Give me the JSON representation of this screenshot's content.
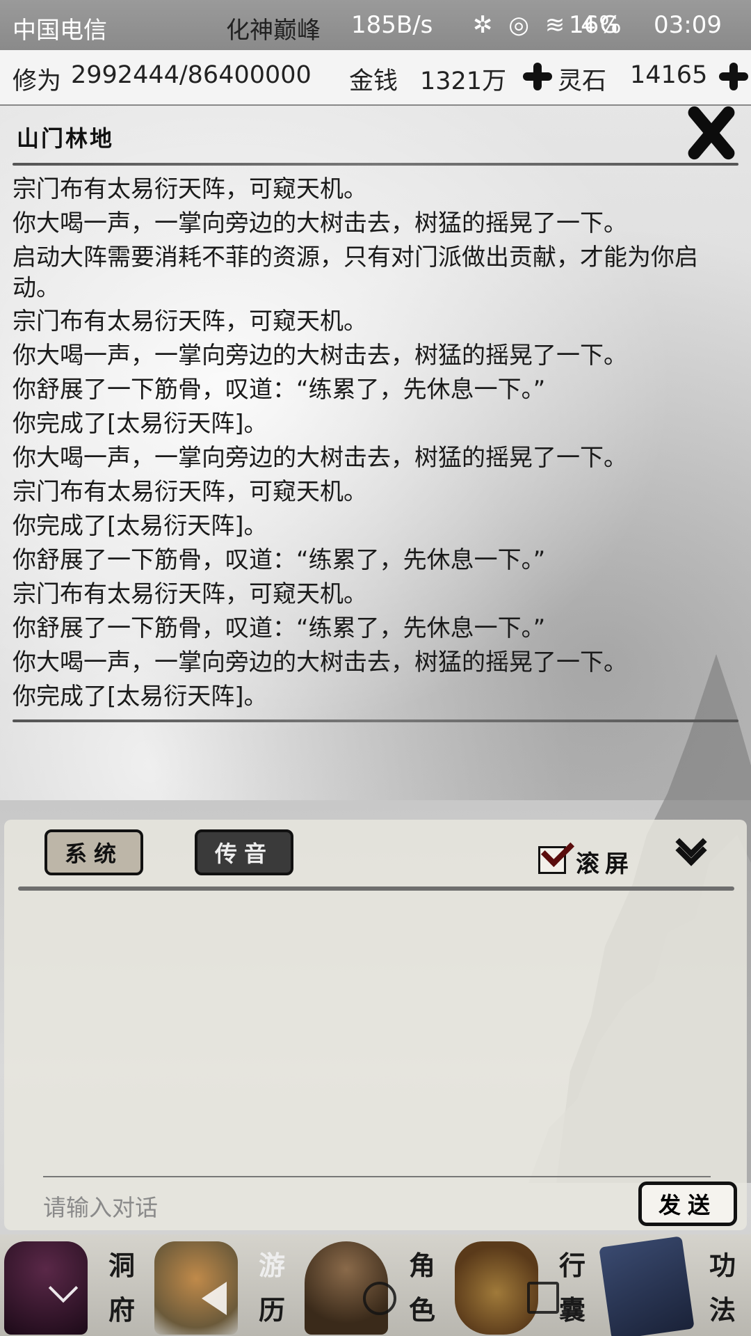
{
  "status_bar": {
    "carrier": "中国电信",
    "realm": "化神巅峰",
    "net_speed": "185B/s",
    "icons_text": "✲ ◎ ≋ 4G",
    "battery": "16%",
    "time": "03:09"
  },
  "stats": {
    "cultivation_label": "修为",
    "cultivation_value": "2992444/86400000",
    "money_label": "金钱",
    "money_value": "1321万",
    "spirit_stone_label": "灵石",
    "spirit_stone_value": "14165"
  },
  "location": {
    "title": "山门林地"
  },
  "log": [
    "宗门布有太易衍天阵，可窥天机。",
    "你大喝一声，一掌向旁边的大树击去，树猛的摇晃了一下。",
    "启动大阵需要消耗不菲的资源，只有对门派做出贡献，才能为你启动。",
    "宗门布有太易衍天阵，可窥天机。",
    "你大喝一声，一掌向旁边的大树击去，树猛的摇晃了一下。",
    "你舒展了一下筋骨，叹道：“练累了，先休息一下。”",
    "你完成了[太易衍天阵]。",
    "你大喝一声，一掌向旁边的大树击去，树猛的摇晃了一下。",
    "宗门布有太易衍天阵，可窥天机。",
    "你完成了[太易衍天阵]。",
    "你舒展了一下筋骨，叹道：“练累了，先休息一下。”",
    "宗门布有太易衍天阵，可窥天机。",
    "你舒展了一下筋骨，叹道：“练累了，先休息一下。”",
    "你大喝一声，一掌向旁边的大树击去，树猛的摇晃了一下。",
    "你完成了[太易衍天阵]。"
  ],
  "chat": {
    "tab_system": "系统",
    "tab_voice": "传音",
    "scroll_label": "滚屏",
    "scroll_checked": true,
    "input_placeholder": "请输入对话",
    "send_label": "发送"
  },
  "bottom_nav": [
    {
      "top": "洞",
      "bottom": "府",
      "icon": "cave-dwelling-icon",
      "color": "#3a1530"
    },
    {
      "top": "游",
      "bottom": "历",
      "icon": "travel-icon",
      "color": "#6b5a3a"
    },
    {
      "top": "角",
      "bottom": "色",
      "icon": "character-icon",
      "color": "#4a3a2a"
    },
    {
      "top": "行",
      "bottom": "囊",
      "icon": "bag-icon",
      "color": "#7a5a2a"
    },
    {
      "top": "功",
      "bottom": "法",
      "icon": "skill-book-icon",
      "color": "#2a3350"
    }
  ],
  "colors": {
    "accent_dark": "#111111",
    "check_mark": "#5a0d0d",
    "tab_voice_bg": "#3a3a3a",
    "tab_system_bg": "#bdb6a8"
  }
}
